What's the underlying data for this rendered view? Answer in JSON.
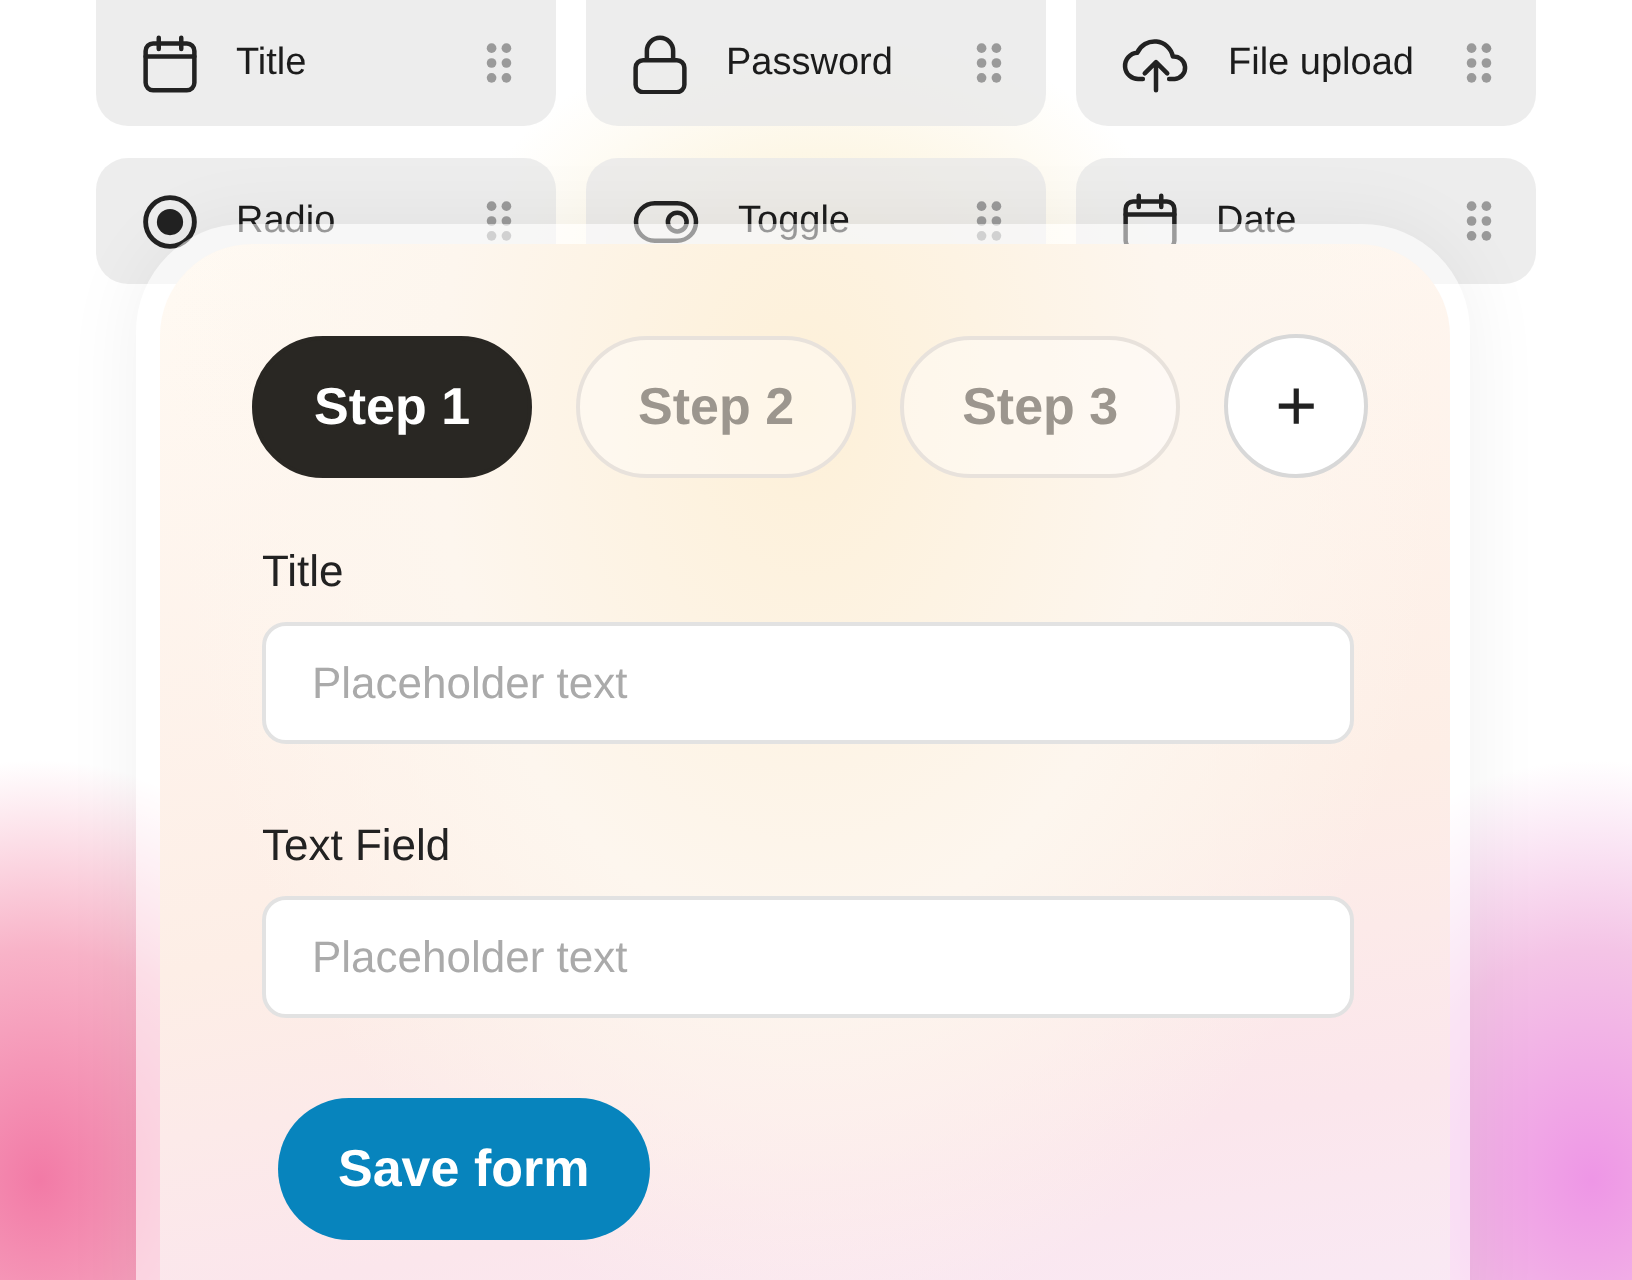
{
  "palette": [
    {
      "kind": "title",
      "label": "Title"
    },
    {
      "kind": "password",
      "label": "Password"
    },
    {
      "kind": "upload",
      "label": "File upload"
    },
    {
      "kind": "radio",
      "label": "Radio"
    },
    {
      "kind": "toggle",
      "label": "Toggle"
    },
    {
      "kind": "date",
      "label": "Date"
    }
  ],
  "steps": [
    {
      "label": "Step 1",
      "selected": true
    },
    {
      "label": "Step 2",
      "selected": false
    },
    {
      "label": "Step 3",
      "selected": false
    }
  ],
  "add_step": "+",
  "fields": [
    {
      "label": "Title",
      "placeholder": "Placeholder text"
    },
    {
      "label": "Text Field",
      "placeholder": "Placeholder text"
    }
  ],
  "save_button": "Save form"
}
